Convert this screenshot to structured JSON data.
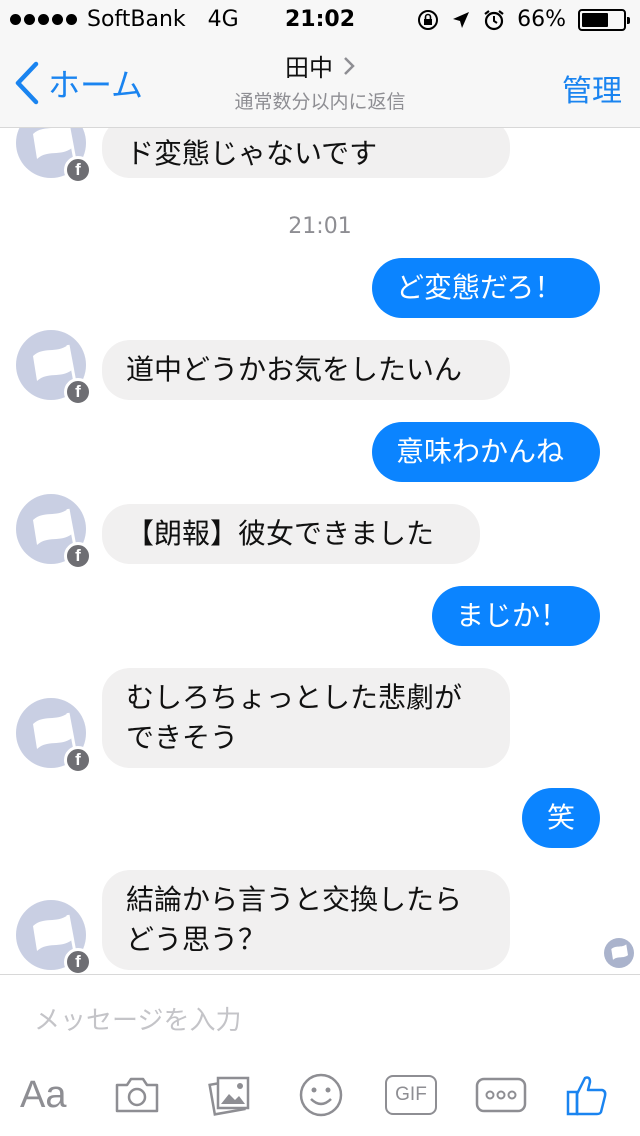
{
  "status_bar": {
    "carrier": "SoftBank",
    "network": "4G",
    "time": "21:02",
    "battery": "66%",
    "battery_level": 0.66
  },
  "nav": {
    "back_label": "ホーム",
    "title": "田中",
    "subtitle": "通常数分以内に返信",
    "manage_label": "管理"
  },
  "messages": {
    "m0": "ド変態じゃないです",
    "timestamp": "21:01",
    "m1": "ど変態だろ！",
    "m2": "道中どうかお気をしたいん",
    "m3": "意味わかんね",
    "m4": "【朗報】彼女できました",
    "m5": "まじか！",
    "m6_line1": "むしろちょっとした悲劇が",
    "m6_line2": "できそう",
    "m7": "笑",
    "m8_line1": "結論から言うと交換したら",
    "m8_line2": "どう思う？"
  },
  "composer": {
    "placeholder": "メッセージを入力",
    "aa_label": "Aa",
    "gif_label": "GIF"
  },
  "colors": {
    "accent": "#1a84f0",
    "outgoing_bubble": "#0b84ff",
    "incoming_bubble": "#f1f0f0"
  }
}
